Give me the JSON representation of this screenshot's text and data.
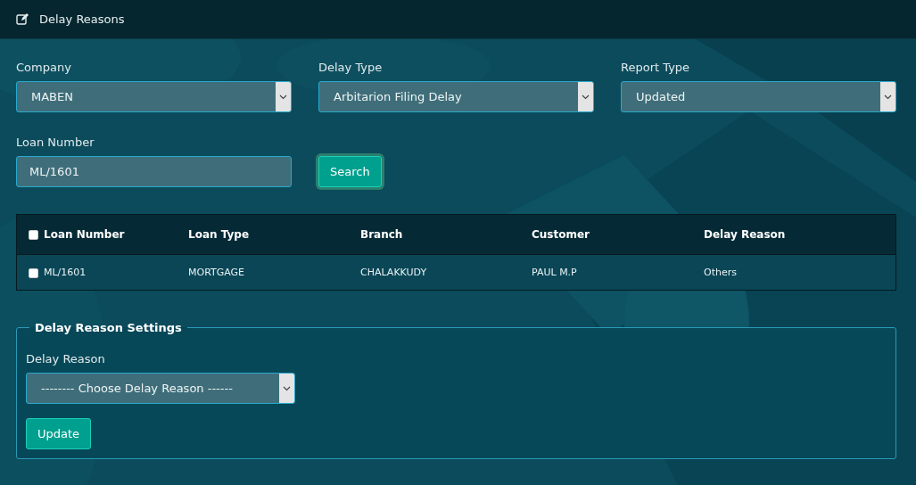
{
  "header": {
    "title": "Delay Reasons"
  },
  "filters": [
    {
      "label": "Company",
      "value": "MABEN"
    },
    {
      "label": "Delay Type",
      "value": "Arbitarion Filing Delay"
    },
    {
      "label": "Report Type",
      "value": "Updated"
    }
  ],
  "loan_number": {
    "label": "Loan Number",
    "value": "ML/1601"
  },
  "search_button": "Search",
  "table": {
    "select_all_checked": false,
    "columns": [
      "Loan Number",
      "Loan Type",
      "Branch",
      "Customer",
      "Delay Reason"
    ],
    "rows": [
      {
        "checked": false,
        "cells": [
          "ML/1601",
          "MORTGAGE",
          "CHALAKKUDY",
          "PAUL M.P",
          "Others"
        ]
      }
    ]
  },
  "settings": {
    "legend": "Delay Reason Settings",
    "label": "Delay Reason",
    "select_value": "-------- Choose Delay Reason ------",
    "button": "Update"
  }
}
